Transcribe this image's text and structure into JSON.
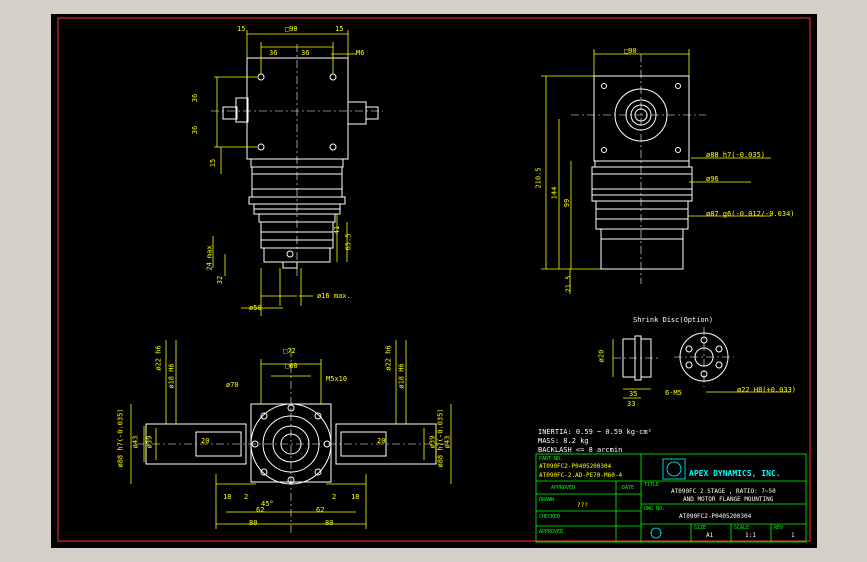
{
  "dims": {
    "sq90": "□90",
    "sq90b": "□90",
    "sq72": "□72",
    "sq60": "□60",
    "d15a": "15",
    "d15b": "15",
    "d36a": "36",
    "d36b": "36",
    "m6": "M6",
    "d36c": "36",
    "d36d": "36",
    "d15c": "15",
    "d1": "41",
    "d2": "65.5",
    "d24": "24 max",
    "d32": "32",
    "phi50": "ø50",
    "phi16": "ø16 max.",
    "d2105": "210.5",
    "d144": "144",
    "d99": "99",
    "d215": "21.5",
    "phi88h7": "ø88 h7(-0.035)",
    "phi96": "ø96",
    "phi87": "ø87 g6(-0.012/-0.034)",
    "shrink": "Shrink Disc(Option)",
    "p20": "ø20",
    "p35": "35",
    "p33": "33",
    "m5": "6-M5",
    "phi22": "ø22 H8(+0.033)",
    "phi70": "ø70",
    "m5x10": "M5x10",
    "phi22h6a": "ø22 h6",
    "phi18h6a": "ø18 H6",
    "phi22h6b": "ø22 h6",
    "phi18h6b": "ø18 H6",
    "phi88l": "ø88 h7(-0.035)",
    "phi43l": "ø43",
    "phi39l": "ø39",
    "d20l": "20",
    "phi88r": "ø88 h7(-0.035)",
    "phi43r": "ø43",
    "phi39r": "ø39",
    "d20r": "20",
    "d18l": "18",
    "d2l": "2",
    "a45": "45°",
    "d62l": "62",
    "d80l": "80",
    "d18r": "18",
    "d2r": "2",
    "d62r": "62",
    "d80r": "80"
  },
  "specs": {
    "inertia": "INERTIA: 0.59 ~ 0.59   kg-cm²",
    "mass": "MASS: 8.2  kg",
    "backlash": "BACKLASH <= 8 arcmin"
  },
  "title_block": {
    "part_no_label": "PART NO.",
    "part_no_1": "AT090FC2-P0405200304",
    "part_no_2": "AT090FC-2.AD-PE70-M60-4",
    "title_label": "TITLE",
    "company": "APEX DYNAMICS, INC.",
    "title_1": "AT090FC 2 STAGE , RATIO: 7~50",
    "title_2": "AND MOTOR FLANGE MOUNTING",
    "approved": "APPROVED",
    "date": "DATE",
    "drawn": "DRAWN",
    "drawn_val": "???",
    "checked": "CHECKED",
    "dwg_no_label": "DWG NO.",
    "dwg_no": "AT090FC2-P0405200304",
    "approver": "APPROVER",
    "size_label": "SIZE",
    "size": "A1",
    "scale_label": "SCALE",
    "scale": "1:1",
    "rev_label": "REV",
    "rev": "1"
  }
}
